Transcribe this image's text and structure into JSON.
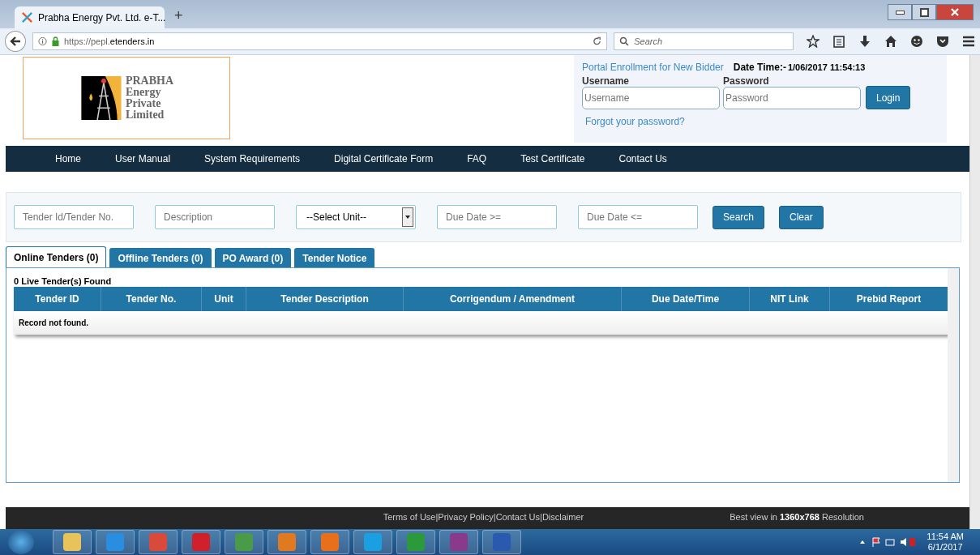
{
  "browser": {
    "tab_title": "Prabha Energy Pvt. Ltd. e-T...",
    "new_tab": "+",
    "url_host": "https://pepl.",
    "url_domain": "etenders.in",
    "search_placeholder": "Search"
  },
  "header": {
    "logo_lines": [
      "PRABHA",
      "Energy",
      "Private",
      "Limited"
    ],
    "enroll_link": "Portal Enrollment for New Bidder",
    "date_label": "Date Time:-",
    "date_value": "1/06/2017 11:54:13",
    "username_label": "Username",
    "username_placeholder": "Username",
    "password_label": "Password",
    "password_placeholder": "Password",
    "login_button": "Login",
    "forgot_link": "Forgot your password?"
  },
  "menu": [
    "Home",
    "User Manual",
    "System Requirements",
    "Digital Certificate Form",
    "FAQ",
    "Test Certificate",
    "Contact Us"
  ],
  "filters": {
    "tender_placeholder": "Tender Id/Tender No.",
    "description_placeholder": "Description",
    "unit_select": "--Select Unit--",
    "due_from_placeholder": "Due Date >=",
    "due_to_placeholder": "Due Date <=",
    "search_button": "Search",
    "clear_button": "Clear"
  },
  "tabs": [
    {
      "label": "Online Tenders (0)",
      "selected": true
    },
    {
      "label": "Offline Tenders (0)",
      "selected": false
    },
    {
      "label": "PO Award (0)",
      "selected": false
    },
    {
      "label": "Tender Notice",
      "selected": false
    }
  ],
  "results": {
    "count": "0 Live Tender(s) Found",
    "columns": [
      "Tender ID",
      "Tender No.",
      "Unit",
      "Tender Description",
      "Corrigendum / Amendment",
      "Due Date/Time",
      "NIT Link",
      "Prebid Report"
    ],
    "empty_message": "Record not found."
  },
  "footer": {
    "links": "Terms of Use|Privacy Policy|Contact Us|Disclaimer",
    "best_view_prefix": "Best view in",
    "best_view_resolution": "1360x768",
    "best_view_suffix": "Resolution"
  },
  "taskbar": {
    "time": "11:54 AM",
    "date": "6/1/2017"
  }
}
